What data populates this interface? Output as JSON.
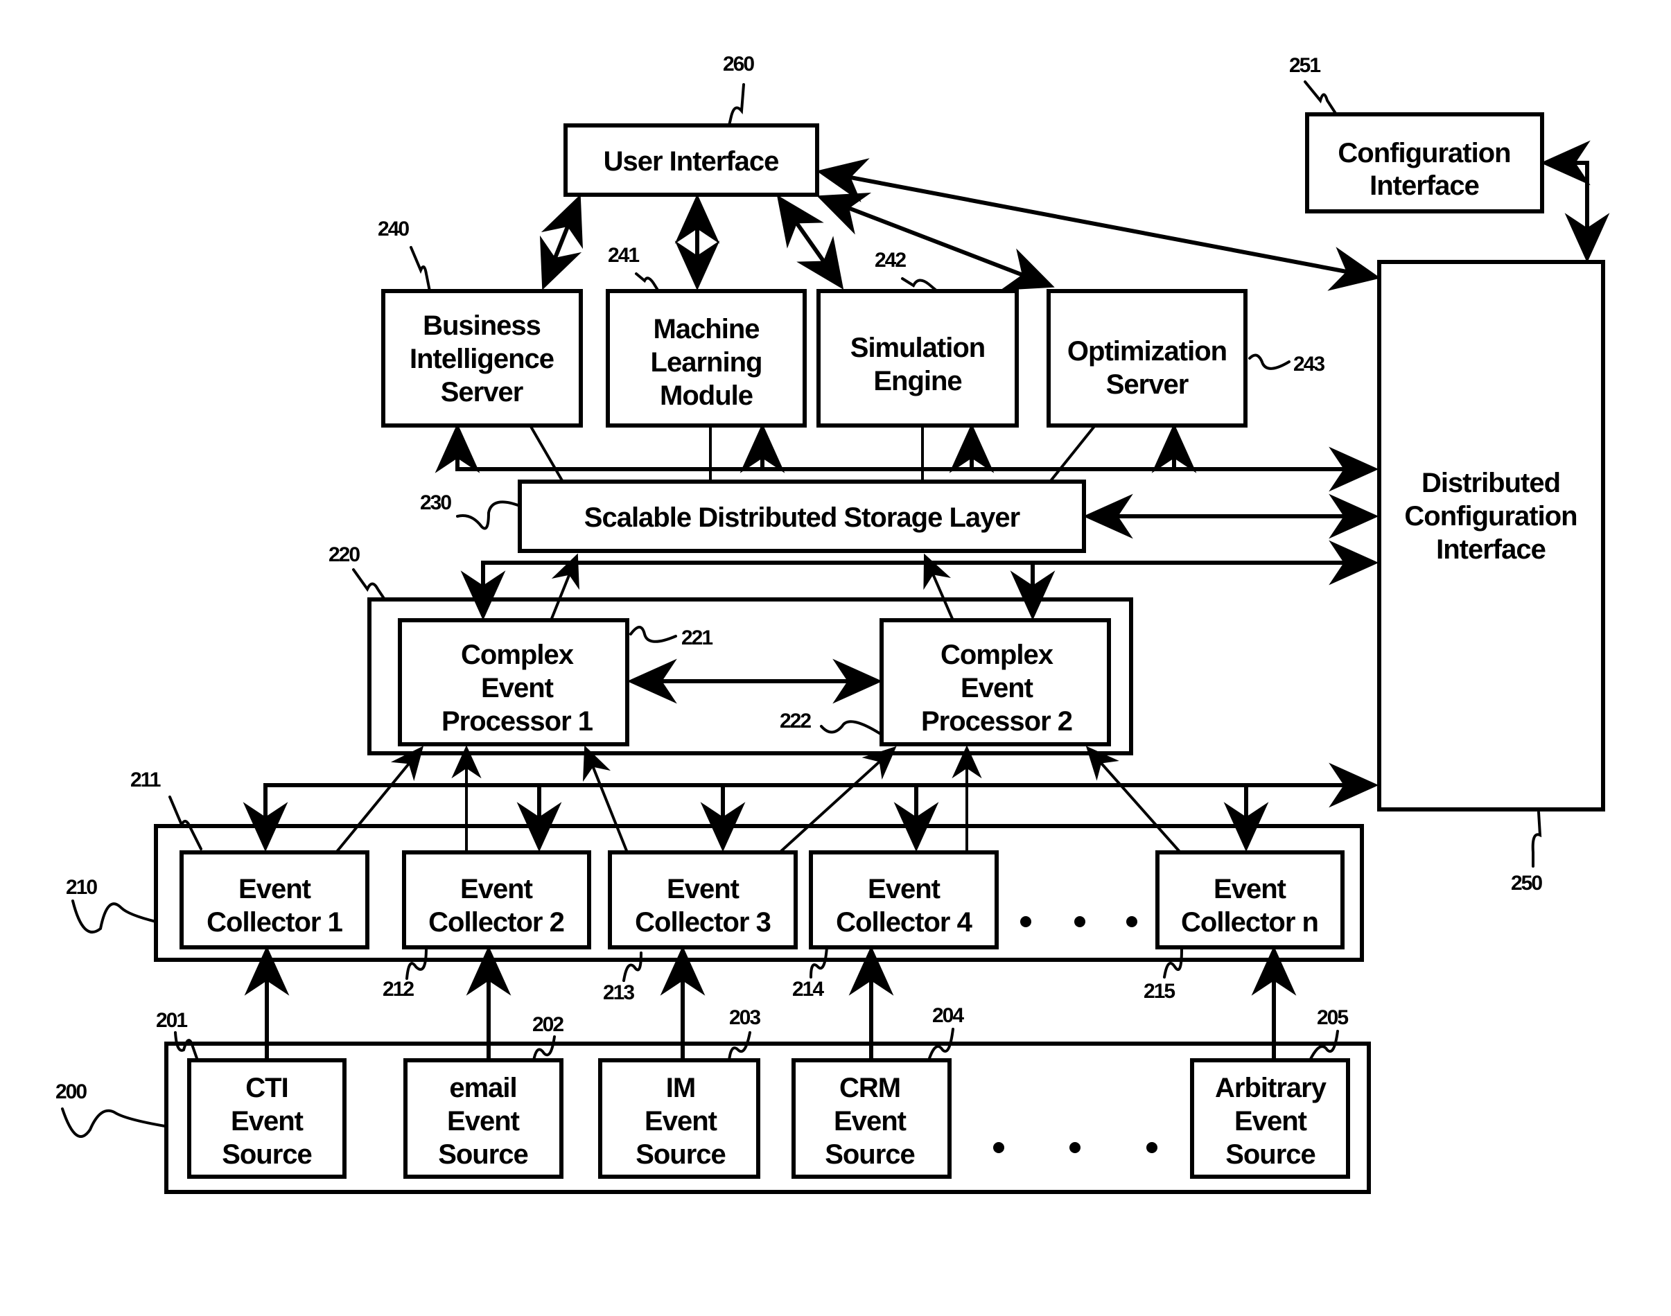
{
  "figure": {
    "components": {
      "user_interface": {
        "ref": "260",
        "lines": [
          "User Interface"
        ]
      },
      "configuration_interface": {
        "ref": "251",
        "lines": [
          "Configuration",
          "Interface"
        ]
      },
      "distributed_configuration_interface": {
        "ref": "250",
        "lines": [
          "Distributed",
          "Configuration",
          "Interface"
        ]
      },
      "business_intelligence_server": {
        "ref": "240",
        "lines": [
          "Business",
          "Intelligence",
          "Server"
        ]
      },
      "machine_learning_module": {
        "ref": "241",
        "lines": [
          "Machine",
          "Learning",
          "Module"
        ]
      },
      "simulation_engine": {
        "ref": "242",
        "lines": [
          "Simulation",
          "Engine"
        ]
      },
      "optimization_server": {
        "ref": "243",
        "lines": [
          "Optimization",
          "Server"
        ]
      },
      "storage_layer": {
        "ref": "230",
        "lines": [
          "Scalable Distributed Storage Layer"
        ]
      },
      "cep_group": {
        "ref": "220"
      },
      "cep_1": {
        "ref": "221",
        "lines": [
          "Complex",
          "Event",
          "Processor 1"
        ]
      },
      "cep_2": {
        "ref": "222",
        "lines": [
          "Complex",
          "Event",
          "Processor 2"
        ]
      },
      "collector_group": {
        "ref": "210",
        "ref_inner": "211"
      },
      "collector_1": {
        "ref": "211",
        "lines": [
          "Event",
          "Collector 1"
        ]
      },
      "collector_2": {
        "ref": "212",
        "lines": [
          "Event",
          "Collector 2"
        ]
      },
      "collector_3": {
        "ref": "213",
        "lines": [
          "Event",
          "Collector 3"
        ]
      },
      "collector_4": {
        "ref": "214",
        "lines": [
          "Event",
          "Collector 4"
        ]
      },
      "collector_n": {
        "ref": "215",
        "lines": [
          "Event",
          "Collector n"
        ]
      },
      "source_group": {
        "ref": "200"
      },
      "source_cti": {
        "ref": "201",
        "lines": [
          "CTI",
          "Event",
          "Source"
        ]
      },
      "source_email": {
        "ref": "202",
        "lines": [
          "email",
          "Event",
          "Source"
        ]
      },
      "source_im": {
        "ref": "203",
        "lines": [
          "IM",
          "Event",
          "Source"
        ]
      },
      "source_crm": {
        "ref": "204",
        "lines": [
          "CRM",
          "Event",
          "Source"
        ]
      },
      "source_arbitrary": {
        "ref": "205",
        "lines": [
          "Arbitrary",
          "Event",
          "Source"
        ]
      }
    },
    "ellipsis": "• • •"
  }
}
